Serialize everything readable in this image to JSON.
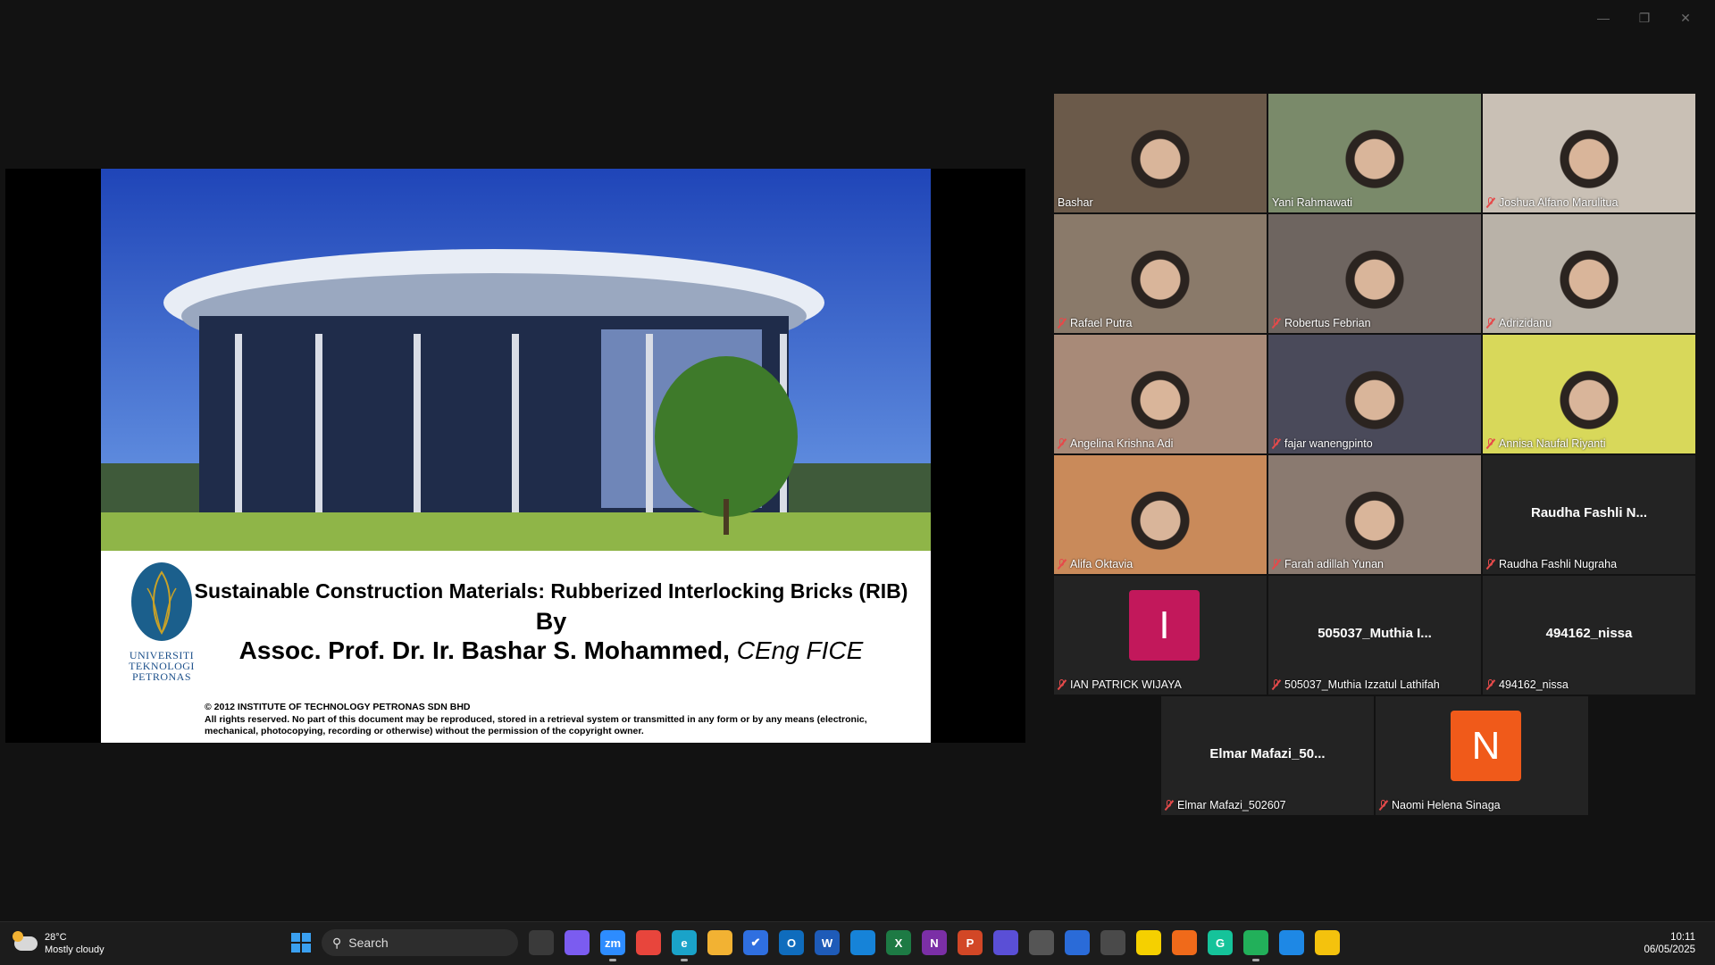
{
  "slide": {
    "title": "Sustainable Construction Materials: Rubberized Interlocking Bricks (RIB)",
    "by": "By",
    "author": "Assoc. Prof. Dr. Ir. Bashar  S. Mohammed,",
    "author_suffix": "CEng FICE",
    "university_lines": [
      "UNIVERSITI",
      "TEKNOLOGI",
      "PETRONAS"
    ],
    "copyright_line1": "© 2012 INSTITUTE OF TECHNOLOGY PETRONAS SDN BHD",
    "copyright_line2": "All rights reserved. No part of this document may be reproduced, stored in a retrieval system or transmitted in any form or by any means (electronic, mechanical, photocopying, recording or otherwise) without the permission of the copyright owner."
  },
  "participants": [
    {
      "name": "Bashar",
      "video": true,
      "active": false
    },
    {
      "name": "Yani Rahmawati",
      "video": true,
      "active": true
    },
    {
      "name": "Joshua Alfano Marulitua",
      "video": true,
      "active": false
    },
    {
      "name": "Rafael Putra",
      "video": true,
      "active": false
    },
    {
      "name": "Robertus Febrian",
      "video": true,
      "active": false
    },
    {
      "name": "Adrizidanu",
      "video": true,
      "active": false
    },
    {
      "name": "Angelina Krishna Adi",
      "video": true,
      "active": false
    },
    {
      "name": "fajar wanengpinto",
      "video": true,
      "active": false
    },
    {
      "name": "Annisa Naufal Riyanti",
      "video": true,
      "active": false
    },
    {
      "name": "Alifa Oktavia",
      "video": true,
      "active": false
    },
    {
      "name": "Farah adillah Yunan",
      "video": true,
      "active": false
    },
    {
      "name": "Raudha Fashli Nugraha",
      "video": false,
      "display": "Raudha Fashli N..."
    },
    {
      "name": "IAN PATRICK WIJAYA",
      "video": false,
      "avatar_letter": "I",
      "avatar_color": "#c2185b"
    },
    {
      "name": "505037_Muthia Izzatul Lathifah",
      "video": false,
      "display": "505037_Muthia I..."
    },
    {
      "name": "494162_nissa",
      "video": false,
      "display": "494162_nissa"
    },
    {
      "name": "Elmar Mafazi_502607",
      "video": false,
      "display": "Elmar  Mafazi_50..."
    },
    {
      "name": "Naomi Helena Sinaga",
      "video": false,
      "avatar_letter": "N",
      "avatar_color": "#f05a1a"
    }
  ],
  "taskbar": {
    "weather_temp": "28°C",
    "weather_desc": "Mostly cloudy",
    "search_placeholder": "Search",
    "time": "10:11",
    "date": "06/05/2025",
    "apps": [
      {
        "icon": "task-view-icon",
        "label": "",
        "color": "#3a3a3a"
      },
      {
        "icon": "copilot-icon",
        "label": "",
        "color": "#7b5cf0"
      },
      {
        "icon": "zoom-icon",
        "label": "zm",
        "color": "#2d8cff"
      },
      {
        "icon": "chrome-icon",
        "label": "",
        "color": "#e8453c"
      },
      {
        "icon": "edge-icon",
        "label": "e",
        "color": "#1aa3c9"
      },
      {
        "icon": "file-explorer-icon",
        "label": "",
        "color": "#f2b233"
      },
      {
        "icon": "todo-icon",
        "label": "✔",
        "color": "#2f6fe0"
      },
      {
        "icon": "outlook-icon",
        "label": "O",
        "color": "#0f6cbd"
      },
      {
        "icon": "word-icon",
        "label": "W",
        "color": "#1e5bb8"
      },
      {
        "icon": "store-icon",
        "label": "",
        "color": "#1683d8"
      },
      {
        "icon": "excel-icon",
        "label": "X",
        "color": "#1d7a44"
      },
      {
        "icon": "onenote-icon",
        "label": "N",
        "color": "#7b2fa6"
      },
      {
        "icon": "powerpoint-icon",
        "label": "P",
        "color": "#d24726"
      },
      {
        "icon": "m365-icon",
        "label": "",
        "color": "#5a4fd6"
      },
      {
        "icon": "camera-icon",
        "label": "",
        "color": "#555"
      },
      {
        "icon": "whiteboard-icon",
        "label": "",
        "color": "#2a6bd8"
      },
      {
        "icon": "calculator-icon",
        "label": "",
        "color": "#4a4a4a"
      },
      {
        "icon": "sticky-notes-icon",
        "label": "",
        "color": "#f5d000"
      },
      {
        "icon": "pie-icon",
        "label": "",
        "color": "#f06a1a"
      },
      {
        "icon": "grammarly-icon",
        "label": "G",
        "color": "#15c39a"
      },
      {
        "icon": "app-green-icon",
        "label": "",
        "color": "#22b05a"
      },
      {
        "icon": "app-blue-icon",
        "label": "",
        "color": "#1e88e5"
      },
      {
        "icon": "app-yellow-icon",
        "label": "",
        "color": "#f4c20d"
      }
    ]
  }
}
